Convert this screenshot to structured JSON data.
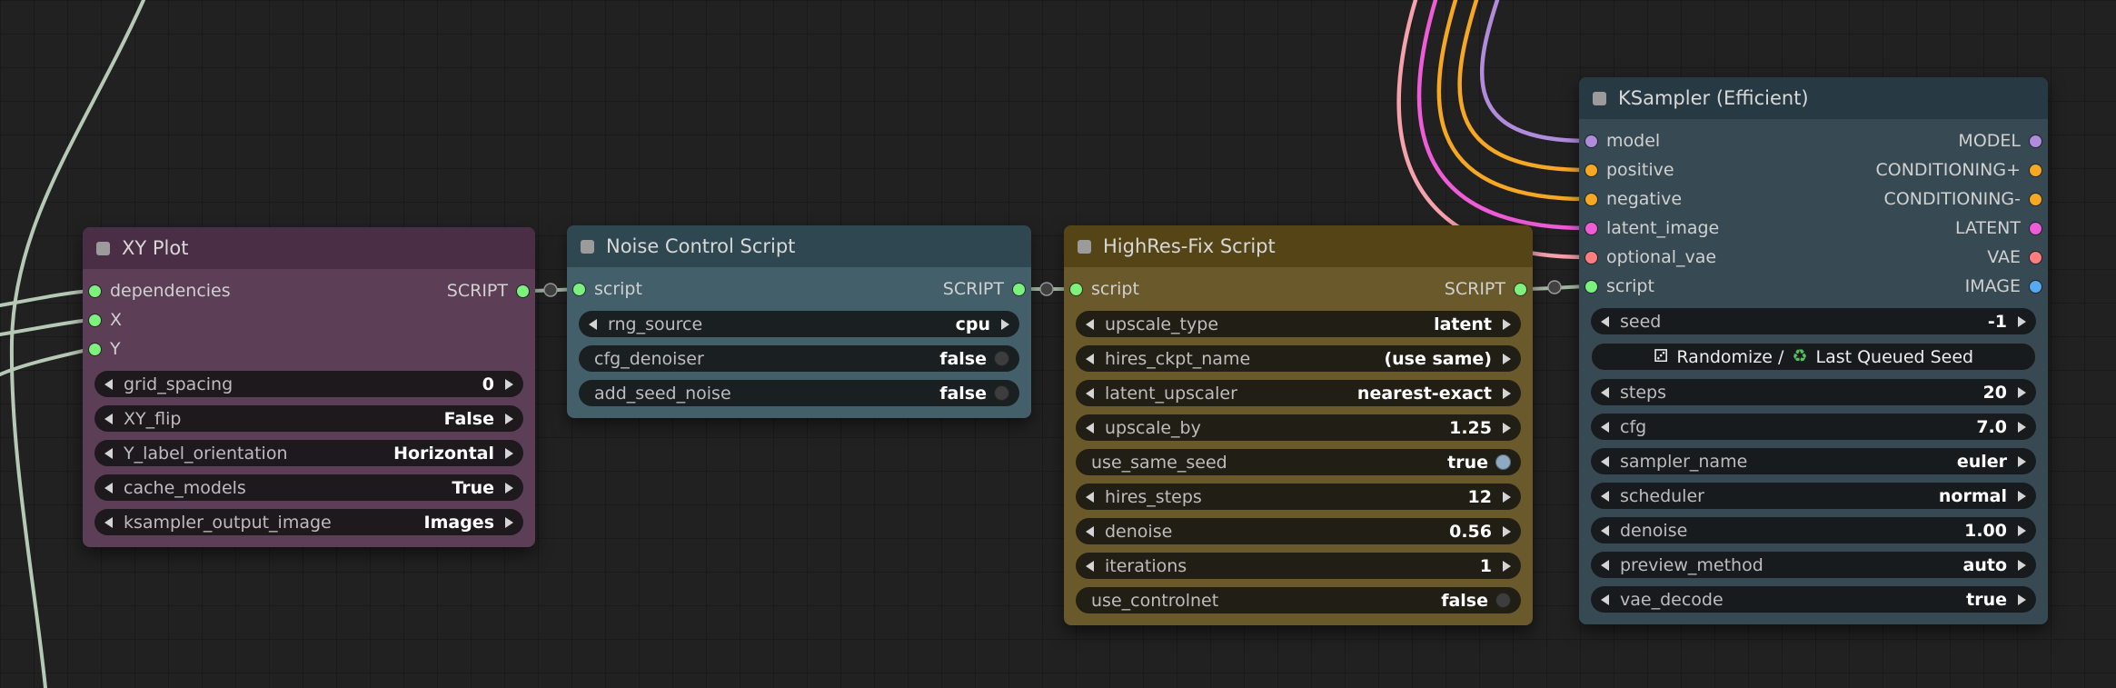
{
  "canvas": {
    "background": "#212121",
    "grid_line": "#1a1a1a"
  },
  "colors": {
    "script_slot": "#7df17d",
    "model": "#b18cdd",
    "conditioning": "#f7a823",
    "latent": "#ef5cd8",
    "vae": "#ff7d7d",
    "image": "#58a8f0",
    "wire_sage": "#b6c9b6",
    "wire_script": "#a5bba5",
    "wire_model": "#b18cdd",
    "wire_conditioning": "#f7a823",
    "wire_latent": "#ef5cd8",
    "wire_vae": "#f7a0ae",
    "toggle_on": "#90a9c3",
    "toggle_off": "#3d3d3d",
    "recycle_green": "#55c15f"
  },
  "nodes": {
    "xy": {
      "title": "XY Plot",
      "title_color": "#4a2e45",
      "body_color": "#5c3e57",
      "inputs": [
        "dependencies",
        "X",
        "Y"
      ],
      "output": "SCRIPT",
      "widgets": [
        {
          "type": "combo",
          "label": "grid_spacing",
          "value": "0"
        },
        {
          "type": "combo",
          "label": "XY_flip",
          "value": "False"
        },
        {
          "type": "combo",
          "label": "Y_label_orientation",
          "value": "Horizontal"
        },
        {
          "type": "combo",
          "label": "cache_models",
          "value": "True"
        },
        {
          "type": "combo",
          "label": "ksampler_output_image",
          "value": "Images"
        }
      ]
    },
    "noise": {
      "title": "Noise Control Script",
      "title_color": "#2e4751",
      "body_color": "#435f69",
      "input": "script",
      "output": "SCRIPT",
      "widgets": [
        {
          "type": "combo",
          "label": "rng_source",
          "value": "cpu"
        },
        {
          "type": "toggle",
          "label": "cfg_denoiser",
          "value": "false",
          "on": false
        },
        {
          "type": "toggle",
          "label": "add_seed_noise",
          "value": "false",
          "on": false
        }
      ]
    },
    "hires": {
      "title": "HighRes-Fix Script",
      "title_color": "#554416",
      "body_color": "#6a592b",
      "input": "script",
      "output": "SCRIPT",
      "widgets": [
        {
          "type": "combo",
          "label": "upscale_type",
          "value": "latent"
        },
        {
          "type": "combo",
          "label": "hires_ckpt_name",
          "value": "(use same)"
        },
        {
          "type": "combo",
          "label": "latent_upscaler",
          "value": "nearest-exact"
        },
        {
          "type": "combo",
          "label": "upscale_by",
          "value": "1.25"
        },
        {
          "type": "toggle",
          "label": "use_same_seed",
          "value": "true",
          "on": true
        },
        {
          "type": "combo",
          "label": "hires_steps",
          "value": "12"
        },
        {
          "type": "combo",
          "label": "denoise",
          "value": "0.56"
        },
        {
          "type": "combo",
          "label": "iterations",
          "value": "1"
        },
        {
          "type": "toggle",
          "label": "use_controlnet",
          "value": "false",
          "on": false
        }
      ]
    },
    "ks": {
      "title": "KSampler (Efficient)",
      "title_color": "#273a44",
      "body_color": "#374a54",
      "slots": [
        {
          "in": "model",
          "out": "MODEL"
        },
        {
          "in": "positive",
          "out": "CONDITIONING+"
        },
        {
          "in": "negative",
          "out": "CONDITIONING-"
        },
        {
          "in": "latent_image",
          "out": "LATENT"
        },
        {
          "in": "optional_vae",
          "out": "VAE"
        },
        {
          "in": "script",
          "out": "IMAGE"
        }
      ],
      "button": {
        "dice_icon": "⚂",
        "text_a": "Randomize /",
        "recycle_icon": "♻",
        "text_b": "Last Queued Seed"
      },
      "widgets": [
        {
          "type": "combo",
          "label": "seed",
          "value": "-1"
        },
        {
          "type": "combo",
          "label": "steps",
          "value": "20"
        },
        {
          "type": "combo",
          "label": "cfg",
          "value": "7.0"
        },
        {
          "type": "combo",
          "label": "sampler_name",
          "value": "euler"
        },
        {
          "type": "combo",
          "label": "scheduler",
          "value": "normal"
        },
        {
          "type": "combo",
          "label": "denoise",
          "value": "1.00"
        },
        {
          "type": "combo",
          "label": "preview_method",
          "value": "auto"
        },
        {
          "type": "combo",
          "label": "vae_decode",
          "value": "true"
        }
      ]
    }
  }
}
